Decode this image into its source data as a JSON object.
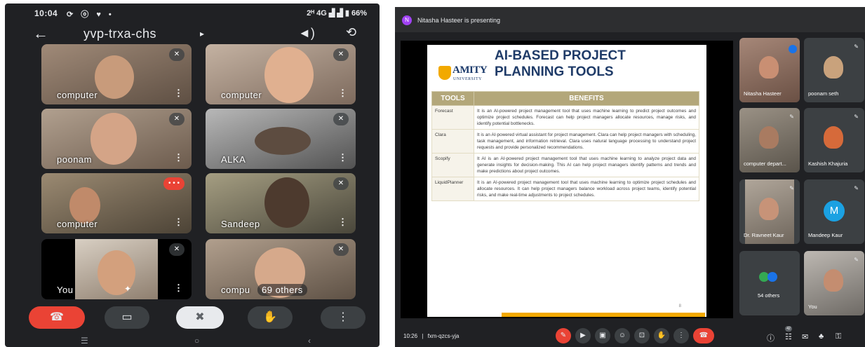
{
  "phone": {
    "status": {
      "time": "10:04",
      "left_icons": "⟳ ⓞ ♥ •",
      "network": "2ᴴ 4G ▟ ▟ ▮ 66%"
    },
    "header": {
      "meeting_code": "yvp-trxa-chs",
      "chevron": "▸"
    },
    "tiles": [
      {
        "name": "computer",
        "bg": "#7a6a5a",
        "face": "#c89b7b"
      },
      {
        "name": "computer",
        "bg": "#9b8676",
        "face": "#e0b090"
      },
      {
        "name": "poonam",
        "bg": "#8c7a6c",
        "face": "#d4a487"
      },
      {
        "name": "ALKA",
        "bg": "#7b7b7b",
        "face": "#5d4c40"
      },
      {
        "name": "computer",
        "bg": "#6e6353",
        "face": "#c08a6a"
      },
      {
        "name": "Sandeep",
        "bg": "#72705e",
        "face": "#4d3a2e"
      },
      {
        "name": "You",
        "bg": "#a99c8c",
        "face": "#d3a07d"
      },
      {
        "name": "compu",
        "bg": "#8a7a6a",
        "face": "#d6a98b",
        "others": "69 others"
      }
    ],
    "controls": {
      "end": "☎",
      "camera": "▭",
      "mute": "✖",
      "hand": "✋",
      "more": "⋮"
    },
    "nav": {
      "menu": "☰",
      "home": "○",
      "back": "‹"
    }
  },
  "desktop": {
    "presenting": {
      "initial": "N",
      "text": "Nitasha Hasteer is presenting"
    },
    "slide": {
      "logo_text": "AMITY",
      "logo_sub": "UNIVERSITY",
      "title": "AI-BASED PROJECT PLANNING TOOLS",
      "col_tools": "TOOLS",
      "col_benefits": "BENEFITS",
      "rows": [
        {
          "tool": "Forecast",
          "benefit": "It is an AI-powered project management tool that uses machine learning to predict project outcomes and optimize project schedules. Forecast can help project managers allocate resources, manage risks, and identify potential bottlenecks."
        },
        {
          "tool": "Clara",
          "benefit": "It is an AI-powered virtual assistant for project management. Clara can help project managers with scheduling, task management, and information retrieval. Clara uses natural language processing to understand project requests and provide personalized recommendations."
        },
        {
          "tool": "Scopify",
          "benefit": "It AI is an AI-powered project management tool that uses machine learning to analyze project data and generate insights for decision-making. This AI can help project managers identify patterns and trends and make predictions about project outcomes."
        },
        {
          "tool": "LiquidPlanner",
          "benefit": "It is an AI-powered project management tool that uses machine learning to optimize project schedules and allocate resources. It can help project managers balance workload across project teams, identify potential risks, and make real-time adjustments to project schedules."
        }
      ],
      "page": "8"
    },
    "participants": [
      {
        "name": "Nitasha Hasteer",
        "bg": "#8a6e62",
        "face": "#c98f73"
      },
      {
        "name": "poonam seth",
        "bg": "#3c4043",
        "face": "#c9a27c"
      },
      {
        "name": "computer depart...",
        "bg": "#6f6a60",
        "face": "#a97b61"
      },
      {
        "name": "Kashish Khajuria",
        "bg": "#3c4043",
        "face": "#d66a3a"
      },
      {
        "name": "Dr. Ravneet Kaur",
        "bg": "#8c8378",
        "face": "#c79378"
      },
      {
        "name": "Mandeep Kaur",
        "bg": "#3c4043",
        "initial": "M"
      },
      {
        "name": "54 others",
        "bg": "#3c4043"
      },
      {
        "name": "You",
        "bg": "#8d8a86",
        "face": "#c48d70"
      }
    ],
    "bottom": {
      "time": "10:26",
      "code": "fxm-qzcs-yja",
      "separator": "|",
      "buttons": [
        "✎",
        "▶",
        "▣",
        "☺",
        "⊡",
        "✋",
        "⋮",
        "☎"
      ],
      "right_icons": [
        "ⓘ",
        "☷",
        "✉",
        "♣",
        "⚿"
      ],
      "badge": "42"
    }
  }
}
